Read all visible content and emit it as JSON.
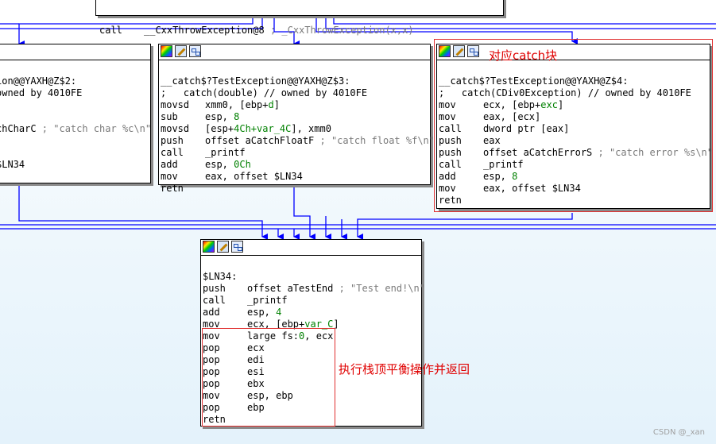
{
  "top_block": {
    "mnem": "call",
    "op": "__CxxThrowException@8",
    "comment": "; _CxxThrowException(x,x)"
  },
  "left_block": {
    "lines": [
      "",
      "ion@@YAXH@Z$2:",
      "owned by 4010FE",
      "]",
      "",
      "chCharC",
      "",
      "",
      "$LN34"
    ],
    "comment": "; \"catch char %c\\n\""
  },
  "mid_block": {
    "label": "__catch$?TestException@@YAXH@Z$3:",
    "catch_comment": ";   catch(double) // owned by 4010FE",
    "code": [
      {
        "m": "movsd",
        "o": "xmm0, [ebp+",
        "n": "d",
        "o2": "]",
        "c": ""
      },
      {
        "m": "sub",
        "o": "esp, ",
        "n": "8",
        "o2": "",
        "c": ""
      },
      {
        "m": "movsd",
        "o": "[esp+",
        "n": "4Ch+var_4C",
        "o2": "], xmm0",
        "c": ""
      },
      {
        "m": "push",
        "o": "offset aCatchFloatF",
        "n": "",
        "o2": "",
        "c": " ; \"catch float %f\\n\""
      },
      {
        "m": "call",
        "o": "_printf",
        "n": "",
        "o2": "",
        "c": ""
      },
      {
        "m": "add",
        "o": "esp, ",
        "n": "0Ch",
        "o2": "",
        "c": ""
      },
      {
        "m": "mov",
        "o": "eax, offset $LN34",
        "n": "",
        "o2": "",
        "c": ""
      },
      {
        "m": "retn",
        "o": "",
        "n": "",
        "o2": "",
        "c": ""
      }
    ]
  },
  "right_block": {
    "label": "__catch$?TestException@@YAXH@Z$4:",
    "catch_comment": ";   catch(CDiv0Exception) // owned by 4010FE",
    "code": [
      {
        "m": "mov",
        "o": "ecx, [ebp+",
        "n": "exc",
        "o2": "]",
        "c": ""
      },
      {
        "m": "mov",
        "o": "eax, [ecx]",
        "n": "",
        "o2": "",
        "c": ""
      },
      {
        "m": "call",
        "o": "dword ptr [eax]",
        "n": "",
        "o2": "",
        "c": ""
      },
      {
        "m": "push",
        "o": "eax",
        "n": "",
        "o2": "",
        "c": ""
      },
      {
        "m": "push",
        "o": "offset aCatchErrorS",
        "n": "",
        "o2": "",
        "c": " ; \"catch error %s\\n\""
      },
      {
        "m": "call",
        "o": "_printf",
        "n": "",
        "o2": "",
        "c": ""
      },
      {
        "m": "add",
        "o": "esp, ",
        "n": "8",
        "o2": "",
        "c": ""
      },
      {
        "m": "mov",
        "o": "eax, offset $LN34",
        "n": "",
        "o2": "",
        "c": ""
      },
      {
        "m": "retn",
        "o": "",
        "n": "",
        "o2": "",
        "c": ""
      }
    ]
  },
  "bottom_block": {
    "label": "$LN34:",
    "code": [
      {
        "m": "push",
        "o": "offset aTestEnd",
        "n": "",
        "o2": "",
        "c": " ; \"Test end!\\n\""
      },
      {
        "m": "call",
        "o": "_printf",
        "n": "",
        "o2": "",
        "c": ""
      },
      {
        "m": "add",
        "o": "esp, ",
        "n": "4",
        "o2": "",
        "c": ""
      },
      {
        "m": "mov",
        "o": "ecx, [ebp+",
        "n": "var_C",
        "o2": "]",
        "c": ""
      },
      {
        "m": "mov",
        "o": "large fs:",
        "n": "0",
        "o2": ", ecx",
        "c": ""
      },
      {
        "m": "pop",
        "o": "ecx",
        "n": "",
        "o2": "",
        "c": ""
      },
      {
        "m": "pop",
        "o": "edi",
        "n": "",
        "o2": "",
        "c": ""
      },
      {
        "m": "pop",
        "o": "esi",
        "n": "",
        "o2": "",
        "c": ""
      },
      {
        "m": "pop",
        "o": "ebx",
        "n": "",
        "o2": "",
        "c": ""
      },
      {
        "m": "mov",
        "o": "esp, ebp",
        "n": "",
        "o2": "",
        "c": ""
      },
      {
        "m": "pop",
        "o": "ebp",
        "n": "",
        "o2": "",
        "c": ""
      },
      {
        "m": "retn",
        "o": "",
        "n": "",
        "o2": "",
        "c": ""
      }
    ]
  },
  "annotations": {
    "catch_block": "对应catch块",
    "stack_balance": "执行栈顶平衡操作并返回"
  },
  "watermark": "CSDN @_xan",
  "colors": {
    "edge": "#0000ff",
    "annotation": "#e00000",
    "immediate": "#008000",
    "comment": "#7a7a7a"
  }
}
